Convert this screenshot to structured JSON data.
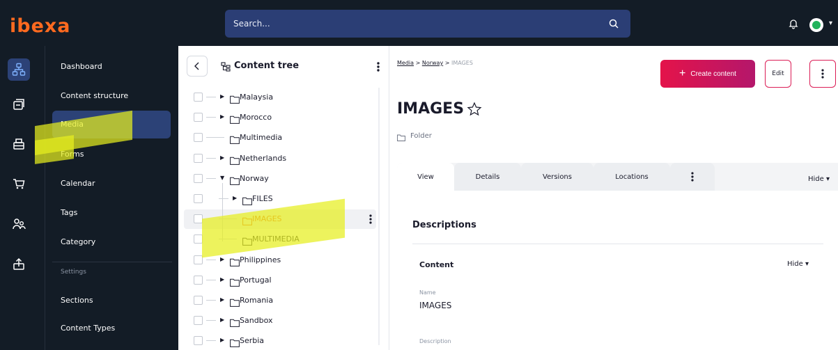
{
  "topbar": {
    "logo": "ibexa",
    "search_placeholder": "Search...",
    "colors": {
      "bar": "#131c26",
      "search": "#2b3e75",
      "logo": "#ff6a1f",
      "avatar_dot": "#21b35c"
    }
  },
  "rail": {
    "icons": [
      "content-tree-icon",
      "content-stack-icon",
      "forms-icon",
      "cart-icon",
      "users-icon",
      "upload-icon"
    ],
    "active_index": 0
  },
  "nav": {
    "items": [
      {
        "label": "Dashboard"
      },
      {
        "label": "Content structure"
      },
      {
        "label": "Media",
        "active": true
      },
      {
        "label": "Forms"
      },
      {
        "label": "Calendar"
      },
      {
        "label": "Tags"
      },
      {
        "label": "Category"
      }
    ],
    "settings_heading": "Settings",
    "settings_items": [
      {
        "label": "Sections"
      },
      {
        "label": "Content Types"
      }
    ]
  },
  "tree": {
    "title": "Content tree",
    "rows": [
      {
        "label": "Malaysia",
        "expandable": true,
        "depth": 0
      },
      {
        "label": "Morocco",
        "expandable": true,
        "depth": 0
      },
      {
        "label": "Multimedia",
        "expandable": false,
        "depth": 0
      },
      {
        "label": "Netherlands",
        "expandable": true,
        "depth": 0
      },
      {
        "label": "Norway",
        "expandable": true,
        "expanded": true,
        "depth": 0
      },
      {
        "label": "FILES",
        "expandable": true,
        "depth": 1
      },
      {
        "label": "IMAGES",
        "expandable": false,
        "depth": 1,
        "selected": true
      },
      {
        "label": "MULTIMEDIA",
        "expandable": false,
        "depth": 1
      },
      {
        "label": "Philippines",
        "expandable": true,
        "depth": 0
      },
      {
        "label": "Portugal",
        "expandable": true,
        "depth": 0
      },
      {
        "label": "Romania",
        "expandable": true,
        "depth": 0
      },
      {
        "label": "Sandbox",
        "expandable": true,
        "depth": 0
      },
      {
        "label": "Serbia",
        "expandable": true,
        "depth": 0
      }
    ]
  },
  "main": {
    "breadcrumb": {
      "first": "Media",
      "second": "Norway",
      "current": "IMAGES",
      "separator": ">"
    },
    "create_label": "Create content",
    "edit_label": "Edit",
    "title": "IMAGES",
    "content_type": "Folder",
    "tabs": [
      {
        "label": "View",
        "active": true
      },
      {
        "label": "Details"
      },
      {
        "label": "Versions"
      },
      {
        "label": "Locations"
      }
    ],
    "hide_label": "Hide",
    "section_title": "Descriptions",
    "group_title": "Content",
    "group_hide": "Hide",
    "fields": [
      {
        "label": "Name",
        "value": "IMAGES"
      },
      {
        "label": "Description",
        "value": ""
      }
    ],
    "colors": {
      "primary": "#db1c55",
      "selected_tree_text": "#e2601b"
    }
  },
  "annotation": {
    "highlight_color": "#e6ee1e"
  }
}
